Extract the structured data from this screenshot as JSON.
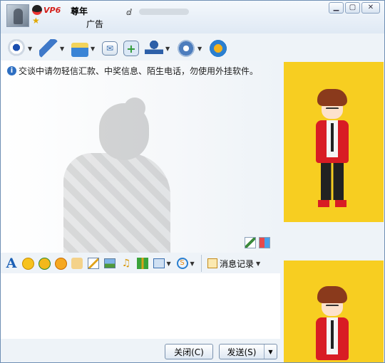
{
  "titlebar": {
    "vip_badge": "VP6",
    "nickname": "尊年",
    "signature": "广告",
    "masked_prefix": "ⅆ"
  },
  "window_buttons": [
    "▁",
    "▢",
    "✕"
  ],
  "toolbar": {
    "icons": [
      "webcam-icon",
      "microphone-icon",
      "send-file-icon",
      "email-icon",
      "add-contact-icon",
      "group-icon",
      "settings-icon",
      "apps-icon"
    ]
  },
  "chat": {
    "notice": "交谈中请勿轻信汇款、中奖信息、陌生电话，勿使用外挂软件。"
  },
  "formatbar": {
    "font_label": "A",
    "message_history": "消息记录"
  },
  "buttons": {
    "close": "关闭(C)",
    "send": "发送(S)"
  },
  "colors": {
    "accent_blue": "#1b5fb5",
    "vip_red": "#d5201b",
    "show_bg": "#f7ce21",
    "jacket_red": "#d81c24"
  }
}
